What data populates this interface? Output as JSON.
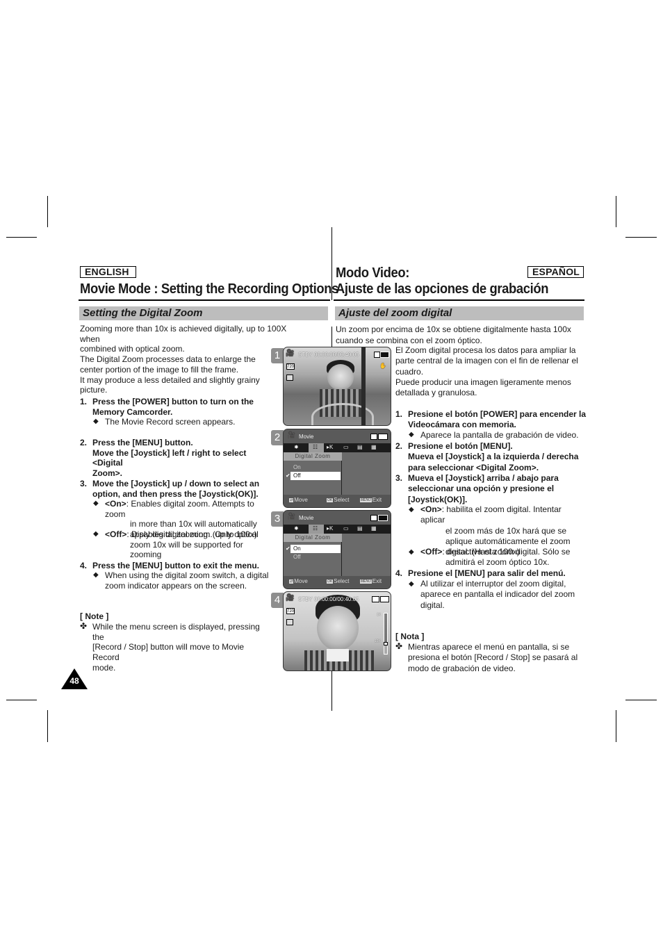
{
  "page_number": "48",
  "english": {
    "language_badge": "ENGLISH",
    "title": "Movie Mode : Setting the Recording Options",
    "section": "Setting the Digital Zoom",
    "intro": [
      "Zooming more than 10x is achieved digitally, up to 100X when",
      "combined with optical zoom.",
      "The Digital Zoom processes data to enlarge the",
      "center portion of the image to fill the frame.",
      "It may produce a less detailed and slightly grainy",
      "picture."
    ],
    "steps": [
      {
        "num": "1.",
        "lines": [
          "Press the [POWER] button to turn on the",
          "Memory Camcorder."
        ],
        "bullets": [
          {
            "label": "",
            "lines": [
              "The Movie Record screen appears."
            ]
          }
        ]
      },
      {
        "num": "2.",
        "lines": [
          "Press the [MENU] button.",
          "Move the [Joystick] left / right to select <Digital",
          "Zoom>."
        ],
        "bullets": []
      },
      {
        "num": "3.",
        "lines": [
          "Move the [Joystick] up / down to select an",
          "option, and then press the [Joystick(OK)]."
        ],
        "bullets": [
          {
            "label": "<On>",
            "lines": [
              ": Enables digital zoom. Attempts to zoom",
              "in more than 10x will automatically",
              "apply digital zooming. (up to 100x)"
            ]
          },
          {
            "label": "<Off>",
            "lines": [
              ": Disables digital zoom. Only optical",
              "zoom 10x will be supported for zooming"
            ]
          }
        ]
      },
      {
        "num": "4.",
        "lines": [
          "Press the [MENU] button to exit the menu."
        ],
        "bullets": [
          {
            "label": "",
            "lines": [
              "When using the digital zoom switch, a digital",
              "zoom indicator appears on the screen."
            ]
          }
        ]
      }
    ],
    "note": {
      "title": "[ Note ]",
      "lines": [
        "While the menu screen is displayed, pressing the",
        "[Record / Stop] button will move to Movie Record",
        "mode."
      ]
    }
  },
  "espanol": {
    "language_badge": "ESPAÑOL",
    "title_line1": "Modo Video:",
    "title_line2": "Ajuste de las opciones de grabación",
    "section": "Ajuste del zoom digital",
    "intro_full": [
      "Un zoom por encima de 10x se obtiene digitalmente hasta 100x",
      "cuando se combina con el zoom óptico."
    ],
    "intro_indented": [
      "El Zoom digital procesa los datos para ampliar la",
      "parte central de la imagen con el fin de rellenar el",
      "cuadro.",
      "Puede producir una imagen ligeramente menos",
      "detallada y granulosa."
    ],
    "steps": [
      {
        "num": "1.",
        "lines": [
          "Presione el botón [POWER] para encender la",
          "Videocámara con memoria."
        ],
        "bullets": [
          {
            "label": "",
            "lines": [
              "Aparece la pantalla de grabación de video."
            ]
          }
        ]
      },
      {
        "num": "2.",
        "lines": [
          "Presione el botón [MENU].",
          "Mueva el [Joystick] a la izquierda / derecha",
          "para seleccionar <Digital Zoom>."
        ],
        "bullets": []
      },
      {
        "num": "3.",
        "lines": [
          "Mueva el [Joystick] arriba / abajo para",
          "seleccionar una opción y presione el",
          "[Joystick(OK)]."
        ],
        "bullets": [
          {
            "label": "<On>",
            "lines": [
              ": habilita el zoom digital. Intentar aplicar",
              "el zoom más de 10x hará que se",
              "aplique automáticamente el zoom",
              "digital. (Hasta 100x)"
            ]
          },
          {
            "label": "<Off>",
            "lines": [
              ": desactiva el zoom digital. Sólo se",
              "admitirá el zoom óptico 10x."
            ]
          }
        ]
      },
      {
        "num": "4.",
        "lines": [
          "Presione el [MENU] para salir del menú."
        ],
        "bullets": [
          {
            "label": "",
            "lines": [
              "Al utilizar el interruptor del zoom digital,",
              "aparece en pantalla el indicador del zoom",
              "digital."
            ]
          }
        ]
      }
    ],
    "note": {
      "title": "[ Nota ]",
      "lines": [
        "Mientras aparece el menú en pantalla, si se",
        "presiona el botón [Record / Stop] se pasará al",
        "modo de grabación de video."
      ]
    }
  },
  "screens": [
    {
      "step": "1",
      "type": "record",
      "status": "STBY 00:00:00/00:40:05",
      "icons": [
        "camcorder-icon",
        "quality-720-icon",
        "digital-zoom-icon",
        "battery-icon",
        "memory-icon"
      ]
    },
    {
      "step": "2",
      "type": "menu",
      "mode": "Movie",
      "submenu_title": "Digital Zoom",
      "options": [
        "On",
        "Off"
      ],
      "selected": "Off",
      "footer": {
        "move": "Move",
        "select": "Select",
        "exit": "Exit",
        "ok_key": "OK",
        "menu_key": "MENU"
      }
    },
    {
      "step": "3",
      "type": "menu",
      "mode": "Movie",
      "submenu_title": "Digital Zoom",
      "options": [
        "On",
        "Off"
      ],
      "selected": "On",
      "footer": {
        "move": "Move",
        "select": "Select",
        "exit": "Exit",
        "ok_key": "OK",
        "menu_key": "MENU"
      }
    },
    {
      "step": "4",
      "type": "record",
      "status": "STBY 00:00:00/00:40:05",
      "zoom_scale": {
        "top_label": "1X",
        "mid_label": "10X"
      },
      "zoom_level_fraction": 0.2
    }
  ],
  "symbols": {
    "diamond": "◆",
    "note_glyph": "✤",
    "check": "✔"
  }
}
